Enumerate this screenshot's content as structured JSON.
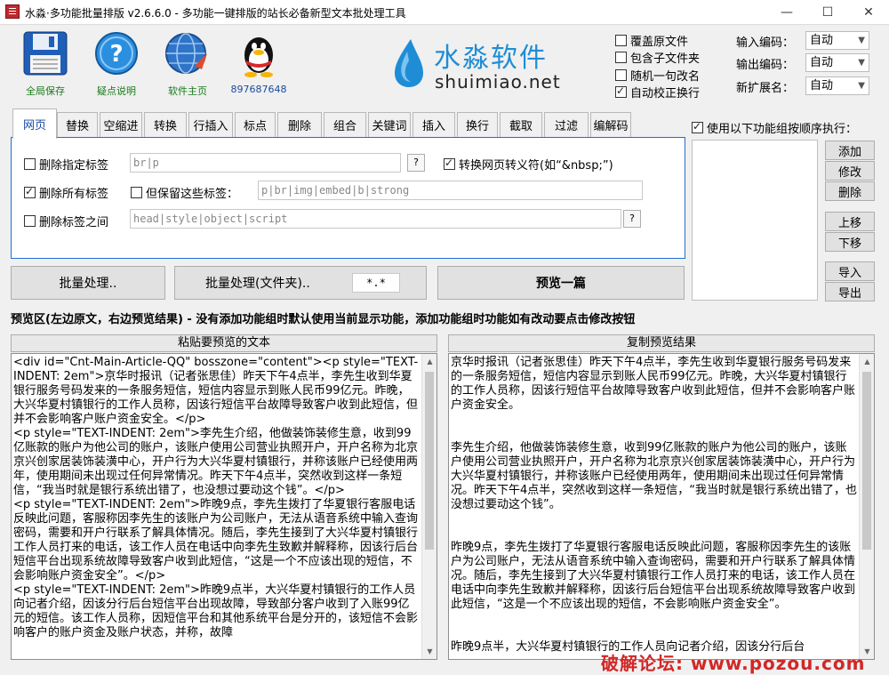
{
  "window": {
    "title": "水淼·多功能批量排版 v2.6.6.0 - 多功能一键排版的站长必备新型文本批处理工具",
    "minimize": "—",
    "maximize": "☐",
    "close": "✕"
  },
  "toolbar": {
    "save": "全局保存",
    "help": "疑点说明",
    "home": "软件主页",
    "qq": "897687648"
  },
  "logo": {
    "cn": "水淼软件",
    "en": "shuimiao.net"
  },
  "options": {
    "overwrite": {
      "label": "覆盖原文件",
      "checked": false
    },
    "subfolders": {
      "label": "包含子文件夹",
      "checked": false
    },
    "random_rename": {
      "label": "随机一句改名",
      "checked": false
    },
    "auto_wrap": {
      "label": "自动校正换行",
      "checked": true
    }
  },
  "encoding": {
    "input_label": "输入编码：",
    "input_value": "自动",
    "output_label": "输出编码：",
    "output_value": "自动",
    "ext_label": "新扩展名：",
    "ext_value": "自动"
  },
  "tabs": [
    "网页",
    "替换",
    "空缩进",
    "转换",
    "行插入",
    "标点",
    "删除",
    "组合",
    "关键词",
    "插入",
    "换行",
    "截取",
    "过滤",
    "编解码"
  ],
  "web_panel": {
    "delete_tags_label": "删除指定标签",
    "delete_tags_value": "br|p",
    "convert_entities_label": "转换网页转义符(如“&nbsp;”)",
    "delete_all_label": "删除所有标签",
    "keep_label": "但保留这些标签：",
    "keep_value": "p|br|img|embed|b|strong",
    "between_label": "删除标签之间",
    "between_value": "head|style|object|script",
    "q": "?"
  },
  "actions": {
    "batch": "批量处理..",
    "batch_folder": "批量处理(文件夹)..",
    "filter": "*.*",
    "preview": "预览一篇"
  },
  "group": {
    "use_label": "使用以下功能组按顺序执行：",
    "add": "添加",
    "edit": "修改",
    "delete": "删除",
    "up": "上移",
    "down": "下移",
    "import": "导入",
    "export": "导出"
  },
  "info": "预览区(左边原文，右边预览结果) - 没有添加功能组时默认使用当前显示功能，添加功能组时功能如有改动要点击修改按钮",
  "left_pane": {
    "title": "粘贴要预览的文本",
    "text": "<div id=\"Cnt-Main-Article-QQ\" bosszone=\"content\"><p style=\"TEXT-INDENT: 2em\">京华时报讯（记者张思佳）昨天下午4点半，李先生收到华夏银行服务号码发来的一条服务短信，短信内容显示到账人民币99亿元。昨晚，大兴华夏村镇银行的工作人员称，因该行短信平台故障导致客户收到此短信，但并不会影响客户账户资金安全。</p>\n<p style=\"TEXT-INDENT: 2em\">李先生介绍，他做装饰装修生意，收到99亿账款的账户为他公司的账户，该账户使用公司营业执照开户，开户名称为北京京兴创家居装饰装潢中心，开户行为大兴华夏村镇银行，并称该账户已经使用两年，使用期间未出现过任何异常情况。昨天下午4点半，突然收到这样一条短信，“我当时就是银行系统出错了，也没想过要动这个钱”。</p>\n<p style=\"TEXT-INDENT: 2em\">昨晚9点，李先生拨打了华夏银行客服电话反映此问题，客服称因李先生的该账户为公司账户，无法从语音系统中输入查询密码，需要和开户行联系了解具体情况。随后，李先生接到了大兴华夏村镇银行工作人员打来的电话，该工作人员在电话中向李先生致歉并解释称，因该行后台短信平台出现系统故障导致客户收到此短信，“这是一个不应该出现的短信，不会影响账户资金安全”。</p>\n<p style=\"TEXT-INDENT: 2em\">昨晚9点半，大兴华夏村镇银行的工作人员向记者介绍，因该分行后台短信平台出现故障，导致部分客户收到了入账99亿元的短信。该工作人员称，因短信平台和其他系统平台是分开的，该短信不会影响客户的账户资金及账户状态，并称，故障"
  },
  "right_pane": {
    "title": "复制预览结果",
    "text": "京华时报讯（记者张思佳）昨天下午4点半，李先生收到华夏银行服务号码发来的一条服务短信，短信内容显示到账人民币99亿元。昨晚，大兴华夏村镇银行的工作人员称，因该行短信平台故障导致客户收到此短信，但并不会影响客户账户资金安全。\n\n\n李先生介绍，他做装饰装修生意，收到99亿账款的账户为他公司的账户，该账户使用公司营业执照开户，开户名称为北京京兴创家居装饰装潢中心，开户行为大兴华夏村镇银行，并称该账户已经使用两年，使用期间未出现过任何异常情况。昨天下午4点半，突然收到这样一条短信，“我当时就是银行系统出错了，也没想过要动这个钱”。\n\n\n昨晚9点，李先生拨打了华夏银行客服电话反映此问题，客服称因李先生的该账户为公司账户，无法从语音系统中输入查询密码，需要和开户行联系了解具体情况。随后，李先生接到了大兴华夏村镇银行工作人员打来的电话，该工作人员在电话中向李先生致歉并解释称，因该行后台短信平台出现系统故障导致客户收到此短信，“这是一个不应该出现的短信，不会影响账户资金安全”。\n\n\n昨晚9点半，大兴华夏村镇银行的工作人员向记者介绍，因该分行后台"
  },
  "watermark": "破解论坛: www.pozou.com"
}
